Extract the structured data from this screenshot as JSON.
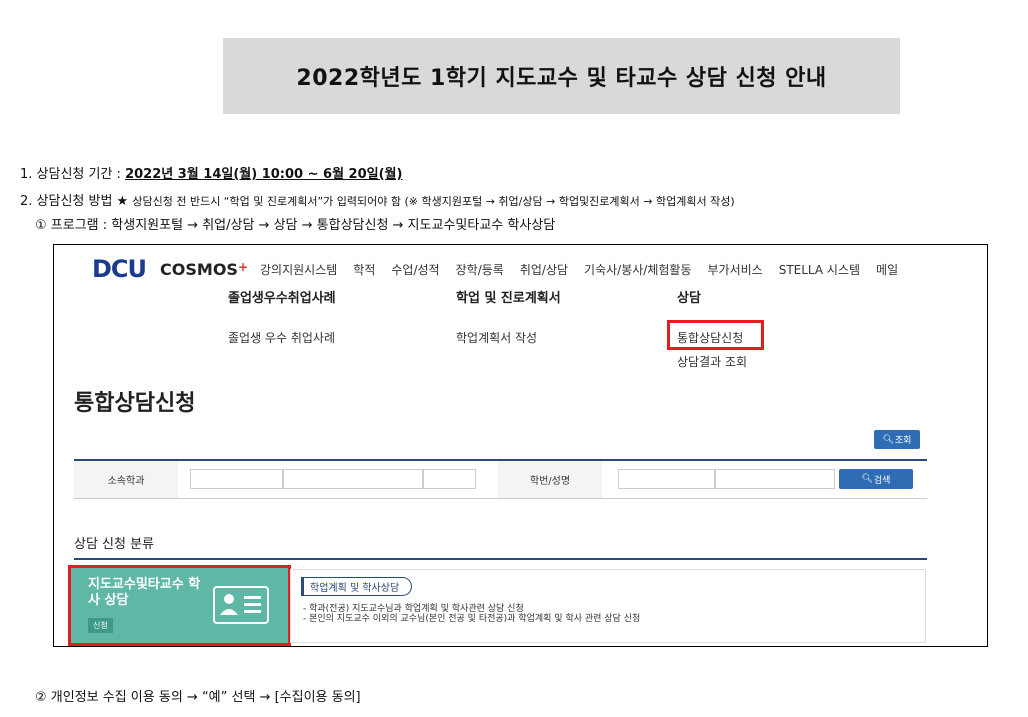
{
  "title": "2022학년도 1학기 지도교수 및 타교수 상담 신청 안내",
  "item1": {
    "prefix": "1. 상담신청 기간 : ",
    "period": "2022년 3월 14일(월) 10:00 ~ 6월 20일(월)"
  },
  "item2": {
    "prefix": "2. 상담신청 방법 ★ ",
    "note": "상담신청 전 반드시 “학업 및 진로계획서”가 입력되어야 함 (※ 학생지원포털 → 취업/상담 → 학업및진로계획서 → 학업계획서 작성)"
  },
  "item3": "① 프로그램 : 학생지원포털 → 취업/상담 → 상담 → 통합상담신청 → 지도교수및타교수 학사상담",
  "item4": "② 개인정보 수집 이용 동의 → “예” 선택 → [수집이용 동의]",
  "screenshot": {
    "logo": "DCU",
    "brand": "COSMOS",
    "brand_plus": "+",
    "nav": [
      "강의지원시스템",
      "학적",
      "수업/성적",
      "장학/등록",
      "취업/상담",
      "기숙사/봉사/체험활동",
      "부가서비스",
      "STELLA 시스템",
      "메일"
    ],
    "menu": {
      "col1_head": "졸업생우수취업사례",
      "col1_item": "졸업생 우수 취업사례",
      "col2_head": "학업 및 진로계획서",
      "col2_item": "학업계획서 작성",
      "col3_head": "상담",
      "col3_item1": "통합상담신청",
      "col3_item2": "상담결과 조회"
    },
    "page_title": "통합상담신청",
    "query_button": "조회",
    "dept_label": "소속학과",
    "id_label": "학번/성명",
    "search_button": "검색",
    "section_title": "상담 신청 분류",
    "card": {
      "title": "지도교수및타교수 학사 상담",
      "badge": "신청"
    },
    "desc": {
      "tag": "학업계획 및 학사상담",
      "line1": "- 학과(전공) 지도교수님과 학업계획 및 학사관련 상담 신청",
      "line2": "- 본인의 지도교수 이외의 교수님(본인 전공 및 타전공)과 학업계획 및 학사 관련 상담 신청"
    },
    "highlight_color": "#e02020",
    "card_color": "#5fb8a6"
  }
}
